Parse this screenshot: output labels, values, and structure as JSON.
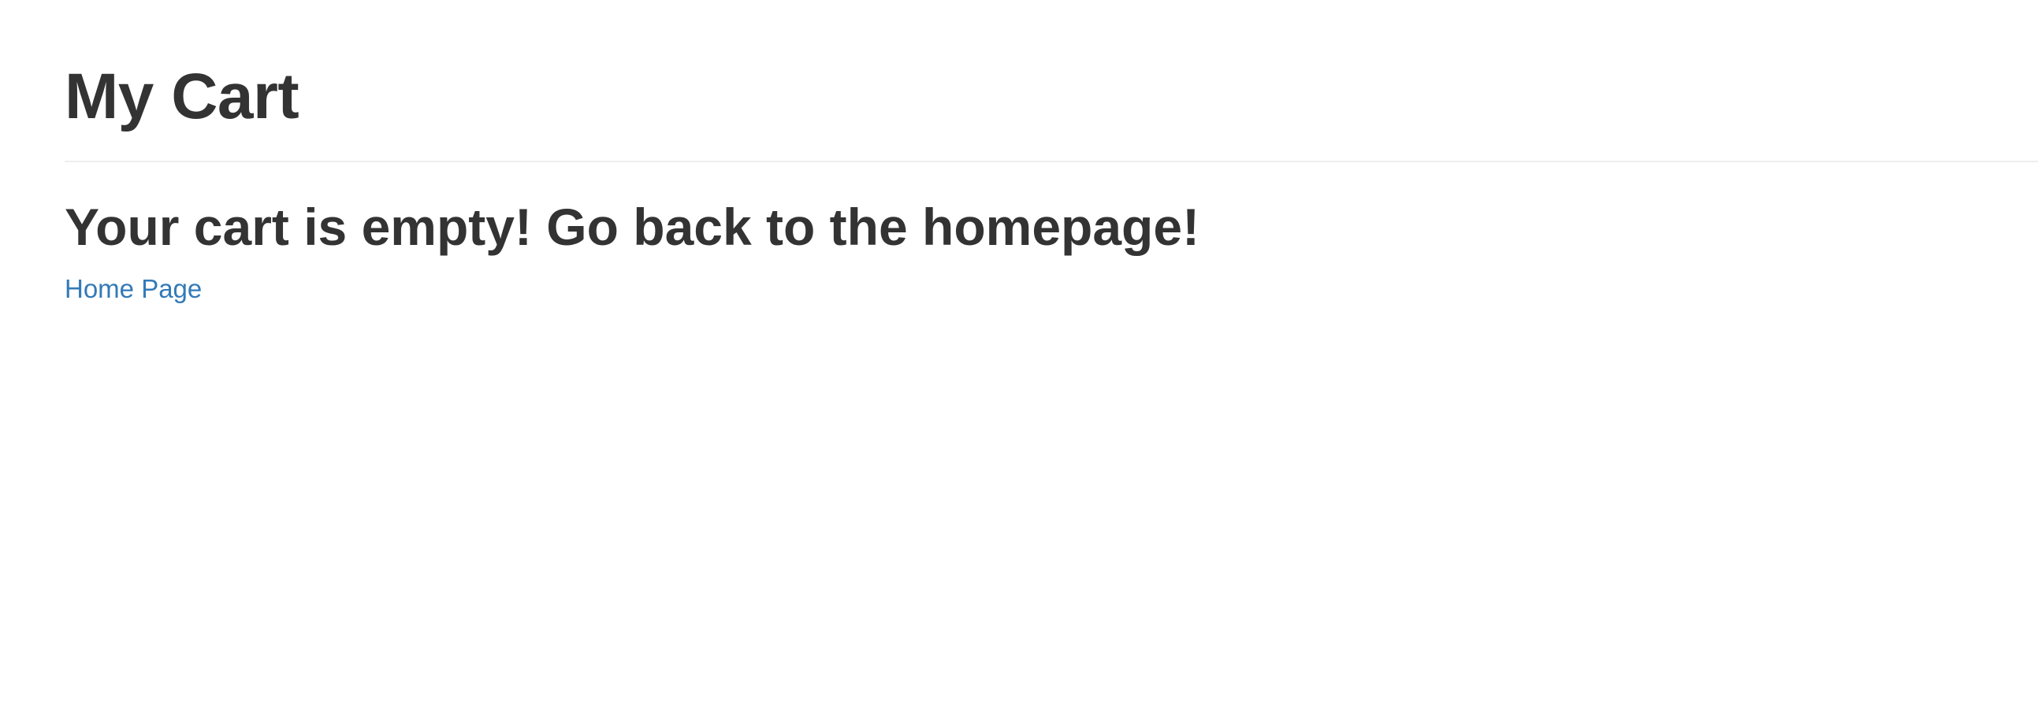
{
  "header": {
    "title": "My Cart"
  },
  "cart": {
    "empty_message": "Your cart is empty! Go back to the homepage!",
    "home_link_label": "Home Page"
  },
  "colors": {
    "text": "#333333",
    "link": "#337ab7",
    "divider": "#eeeeee",
    "background": "#ffffff"
  }
}
